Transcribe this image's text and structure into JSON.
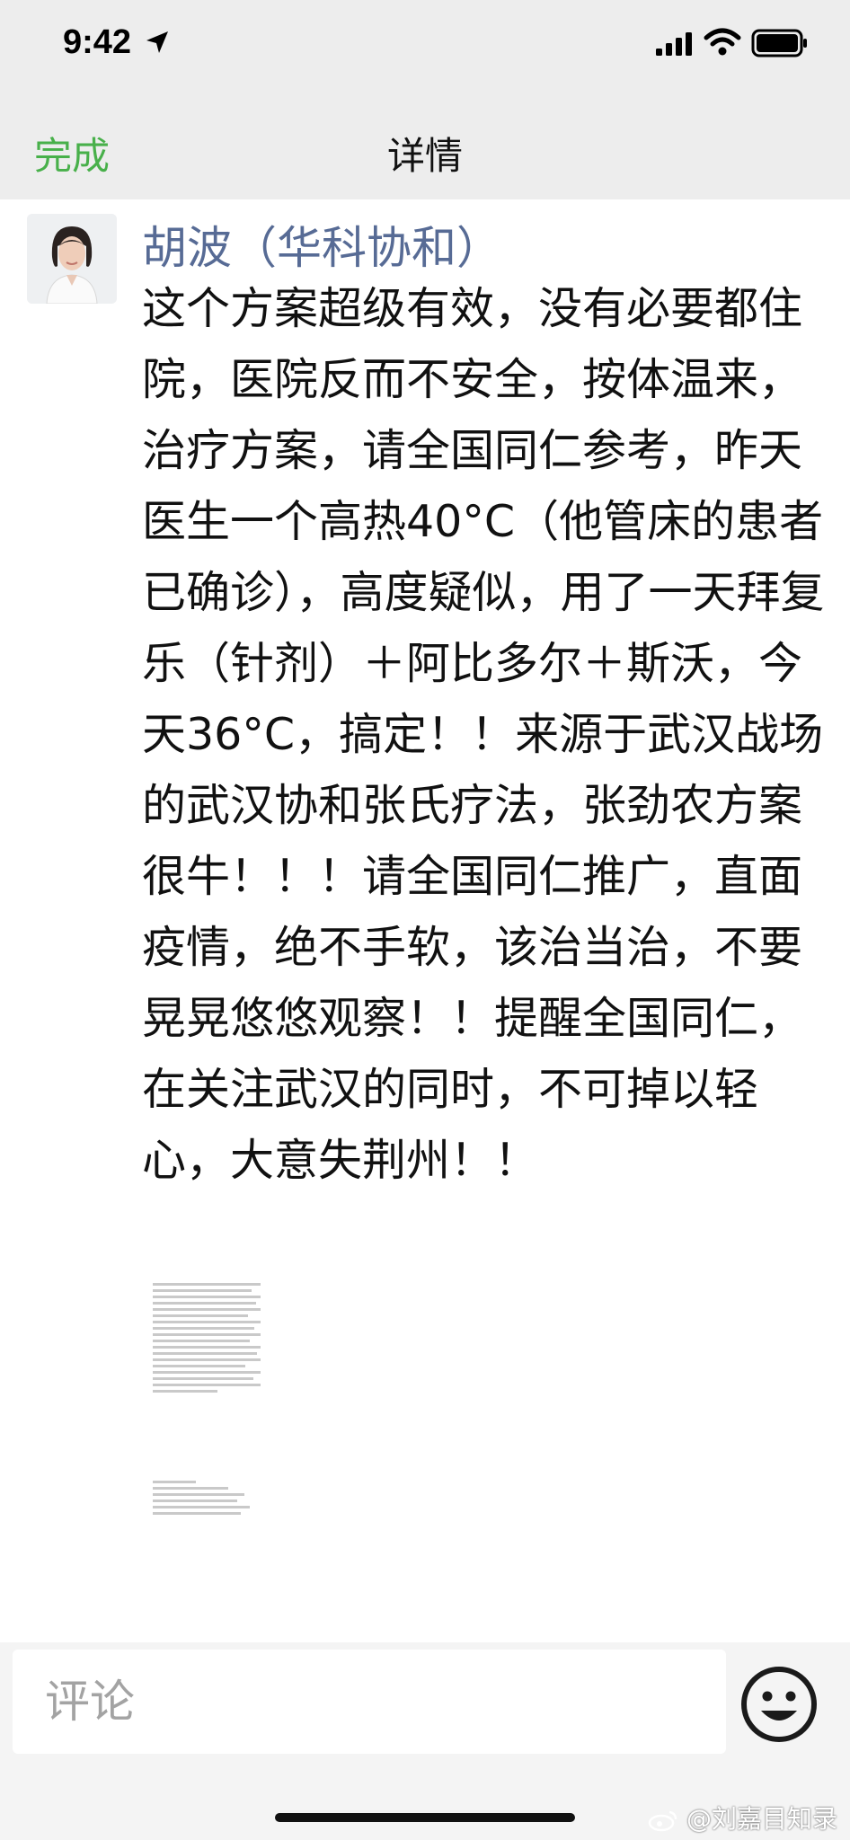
{
  "status_bar": {
    "time": "9:42",
    "icons": [
      "location-arrow-icon",
      "cellular-signal-icon",
      "wifi-icon",
      "battery-icon"
    ]
  },
  "nav": {
    "done_label": "完成",
    "title": "详情",
    "accent_color": "#48b04a"
  },
  "post": {
    "author": "胡波（华科协和）",
    "author_color": "#576b95",
    "text": "这个方案超级有效，没有必要都住院，医院反而不安全，按体温来，治疗方案，请全国同仁参考，昨天医生一个高热40°C（他管床的患者已确诊），高度疑似，用了一天拜复乐（针剂）＋阿比多尔＋斯沃，今天36°C，搞定！！来源于武汉战场的武汉协和张氏疗法，张劲农方案很牛！！！请全国同仁推广，直面疫情，绝不手软，该治当治，不要晃晃悠悠观察！！提醒全国同仁，在关注武汉的同时，不可掉以轻心，大意失荆州！！"
  },
  "comment": {
    "placeholder": "评论"
  },
  "watermark": {
    "text": "@刘嘉目知录"
  }
}
